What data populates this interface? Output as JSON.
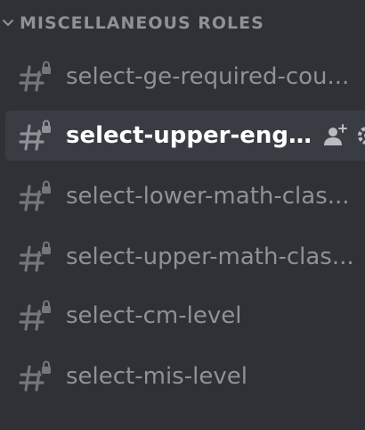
{
  "category": {
    "label": "MISCELLANEOUS ROLES",
    "chevron_icon": "chevron-down-icon"
  },
  "channels": [
    {
      "name": "select-ge-required-cou...",
      "icon": "locked-text-channel-icon"
    },
    {
      "name": "select-upper-engr-...",
      "icon": "locked-text-channel-icon",
      "selected": true,
      "action_icons": [
        "invite-user-icon",
        "settings-icon"
      ]
    },
    {
      "name": "select-lower-math-clas...",
      "icon": "locked-text-channel-icon"
    },
    {
      "name": "select-upper-math-clas...",
      "icon": "locked-text-channel-icon"
    },
    {
      "name": "select-cm-level",
      "icon": "locked-text-channel-icon"
    },
    {
      "name": "select-mis-level",
      "icon": "locked-text-channel-icon"
    }
  ],
  "colors": {
    "background": "#2f3136",
    "selected_background": "#393c43",
    "muted_text": "#8e9297",
    "selected_text": "#ffffff",
    "icon": "#72767d"
  }
}
